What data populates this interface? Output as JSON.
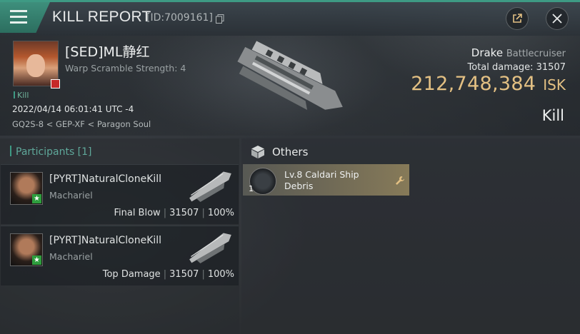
{
  "header": {
    "title": "KILL REPORT",
    "report_id": "[ID:7009161]"
  },
  "victim": {
    "name": "[SED]ML静红",
    "warp_scramble": "Warp Scramble Strength: 4",
    "kill_tag": "Kill",
    "datetime": "2022/04/14 06:01:41 UTC -4",
    "location": "GQ2S-8 < GEP-XF < Paragon Soul",
    "ship_name": "Drake",
    "ship_class": "Battlecruiser",
    "total_damage_label": "Total damage:",
    "total_damage_value": "31507",
    "isk_amount": "212,748,384",
    "isk_unit": "ISK",
    "result": "Kill"
  },
  "participants": {
    "heading": "Participants [1]",
    "rows": [
      {
        "name": "[PYRT]NaturalCloneKill",
        "ship": "Machariel",
        "role": "Final Blow",
        "damage": "31507",
        "percent": "100%"
      },
      {
        "name": "[PYRT]NaturalCloneKill",
        "ship": "Machariel",
        "role": "Top Damage",
        "damage": "31507",
        "percent": "100%"
      }
    ]
  },
  "others": {
    "heading": "Others",
    "items": [
      {
        "qty": "1",
        "name": "Lv.8 Caldari Ship Debris"
      }
    ]
  },
  "colors": {
    "accent": "#3e9a84",
    "isk": "#e3c083"
  }
}
